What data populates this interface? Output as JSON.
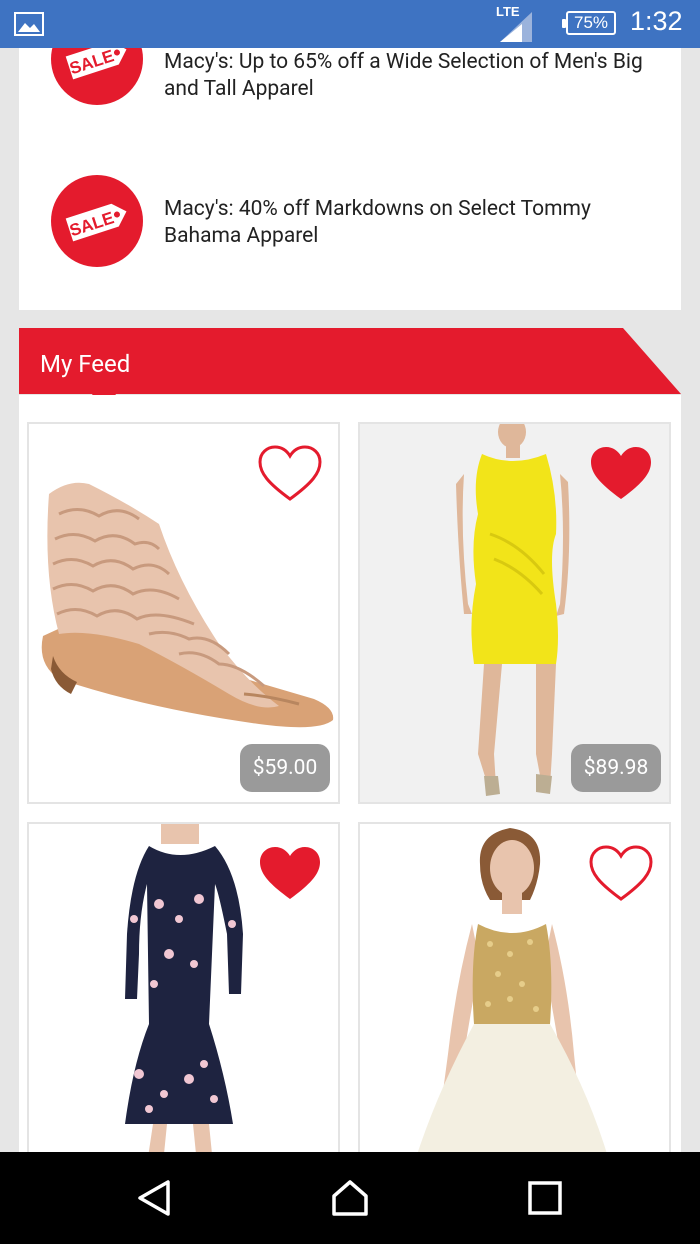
{
  "status_bar": {
    "network": "LTE",
    "battery": "75%",
    "time": "1:32",
    "icons": [
      "image-notification-icon",
      "signal-icon",
      "battery-icon"
    ]
  },
  "deals": [
    {
      "text": "Macy's: Up to 65% off a Wide Selection of Men's Big and Tall Apparel",
      "badge": "SALE"
    },
    {
      "text": "Macy's: 40% off Markdowns on Select Tommy Bahama Apparel",
      "badge": "SALE"
    }
  ],
  "feed": {
    "title": "My Feed",
    "products": [
      {
        "name": "Studded cage sandal",
        "price": "$59.00",
        "favorited": false
      },
      {
        "name": "Yellow sheath dress",
        "price": "$89.98",
        "favorited": true
      },
      {
        "name": "Floral cold-shoulder dress",
        "price": "",
        "favorited": true
      },
      {
        "name": "Gold sequin dress",
        "price": "",
        "favorited": false
      }
    ]
  },
  "colors": {
    "brand_red": "#e41b2d",
    "status_bar_blue": "#3e73c2",
    "price_badge": "#9a9a9a"
  },
  "nav": [
    "back-icon",
    "home-icon",
    "recents-icon"
  ]
}
